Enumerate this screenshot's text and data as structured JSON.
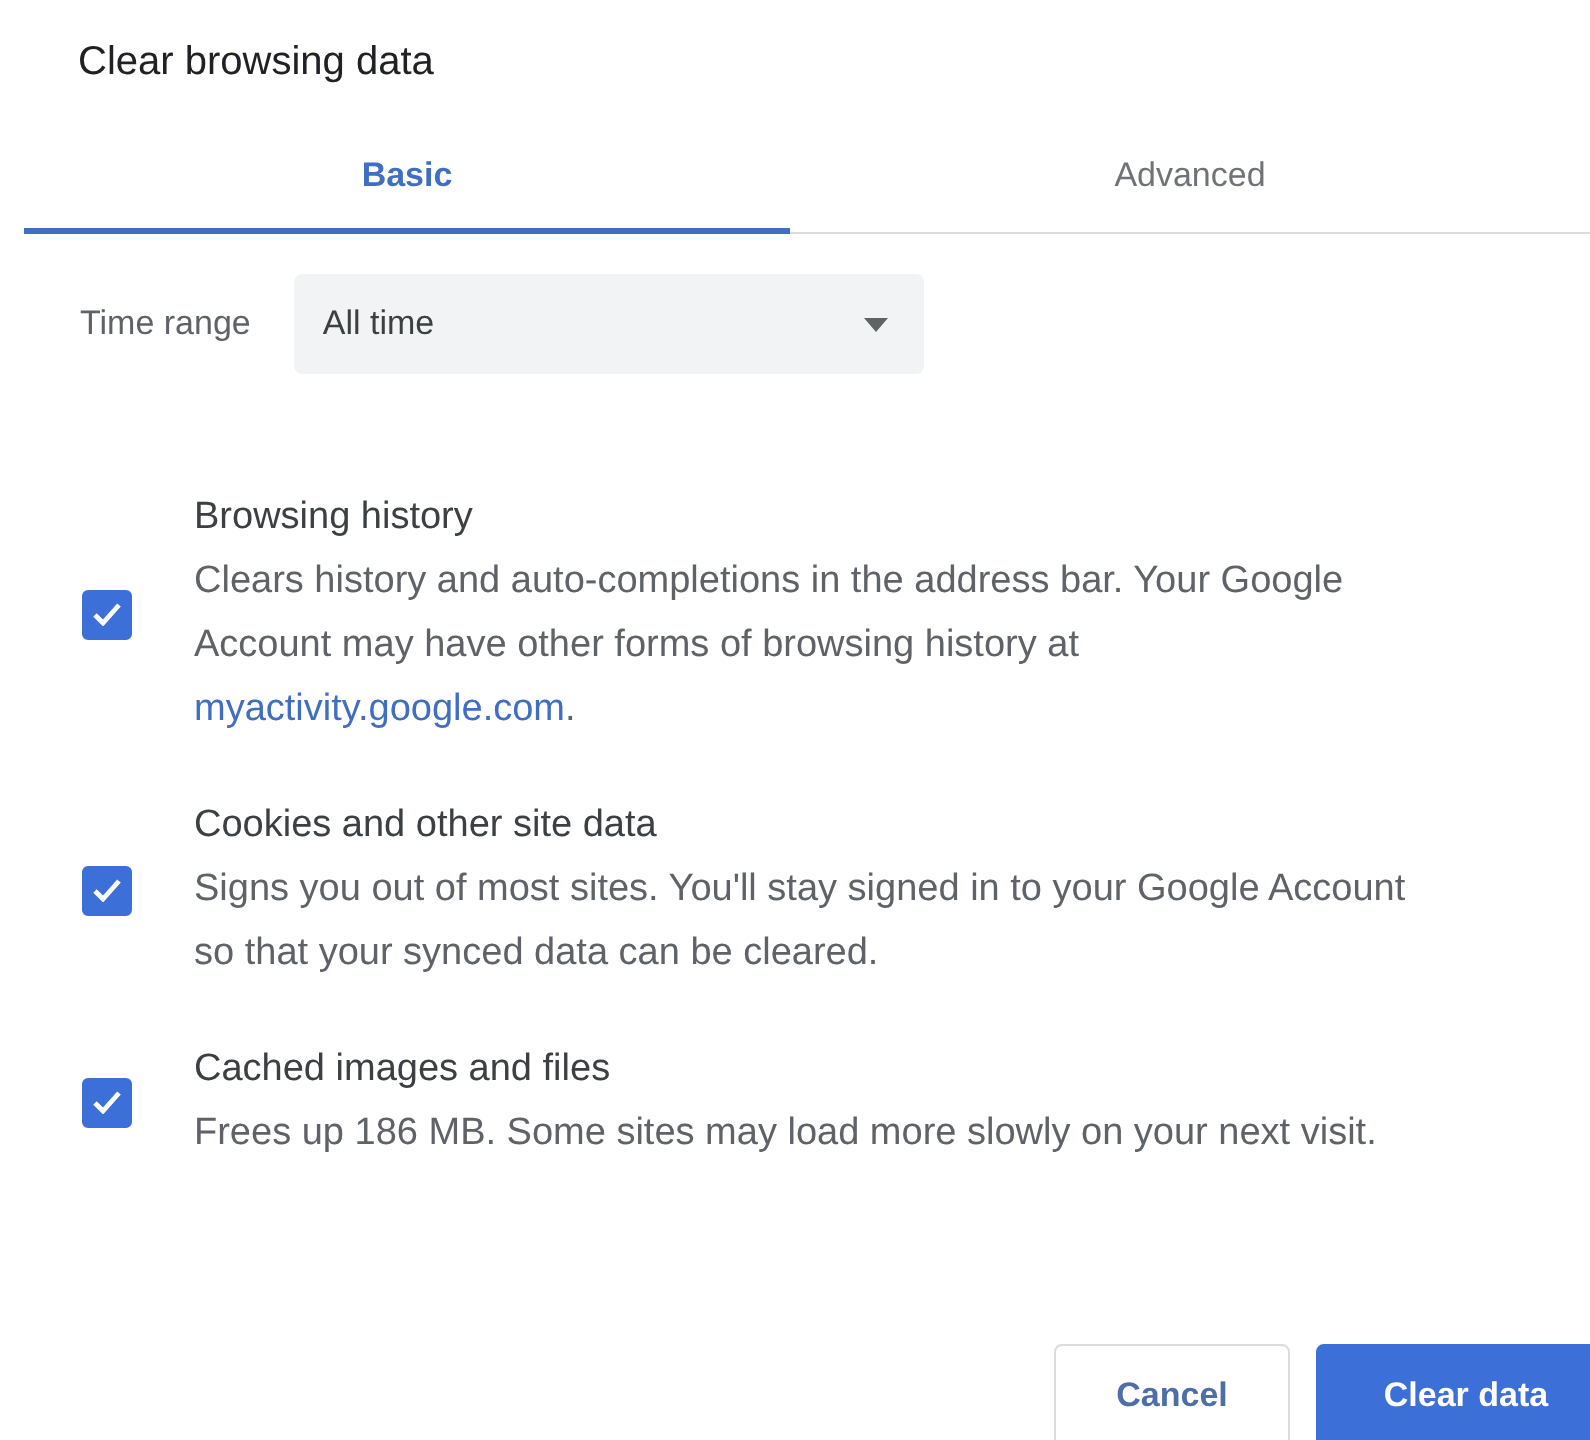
{
  "dialog": {
    "title": "Clear browsing data"
  },
  "tabs": [
    {
      "label": "Basic",
      "selected": true
    },
    {
      "label": "Advanced",
      "selected": false
    }
  ],
  "time_range": {
    "label": "Time range",
    "value": "All time"
  },
  "options": [
    {
      "title": "Browsing history",
      "description_lines": [
        "Clears history and auto-completions in the address bar. Your Google",
        "Account may have other forms of browsing history at"
      ],
      "link": "myactivity.google.com",
      "after_link": ".",
      "checked": true
    },
    {
      "title": "Cookies and other site data",
      "description_lines": [
        "Signs you out of most sites. You'll stay signed in to your Google Account",
        "so that your synced data can be cleared."
      ],
      "checked": true
    },
    {
      "title": "Cached images and files",
      "description_lines": [
        "Frees up 186 MB. Some sites may load more slowly on your next visit."
      ],
      "checked": true
    }
  ],
  "buttons": [
    {
      "label": "Cancel",
      "kind": "secondary"
    },
    {
      "label": "Clear data",
      "kind": "primary"
    }
  ]
}
